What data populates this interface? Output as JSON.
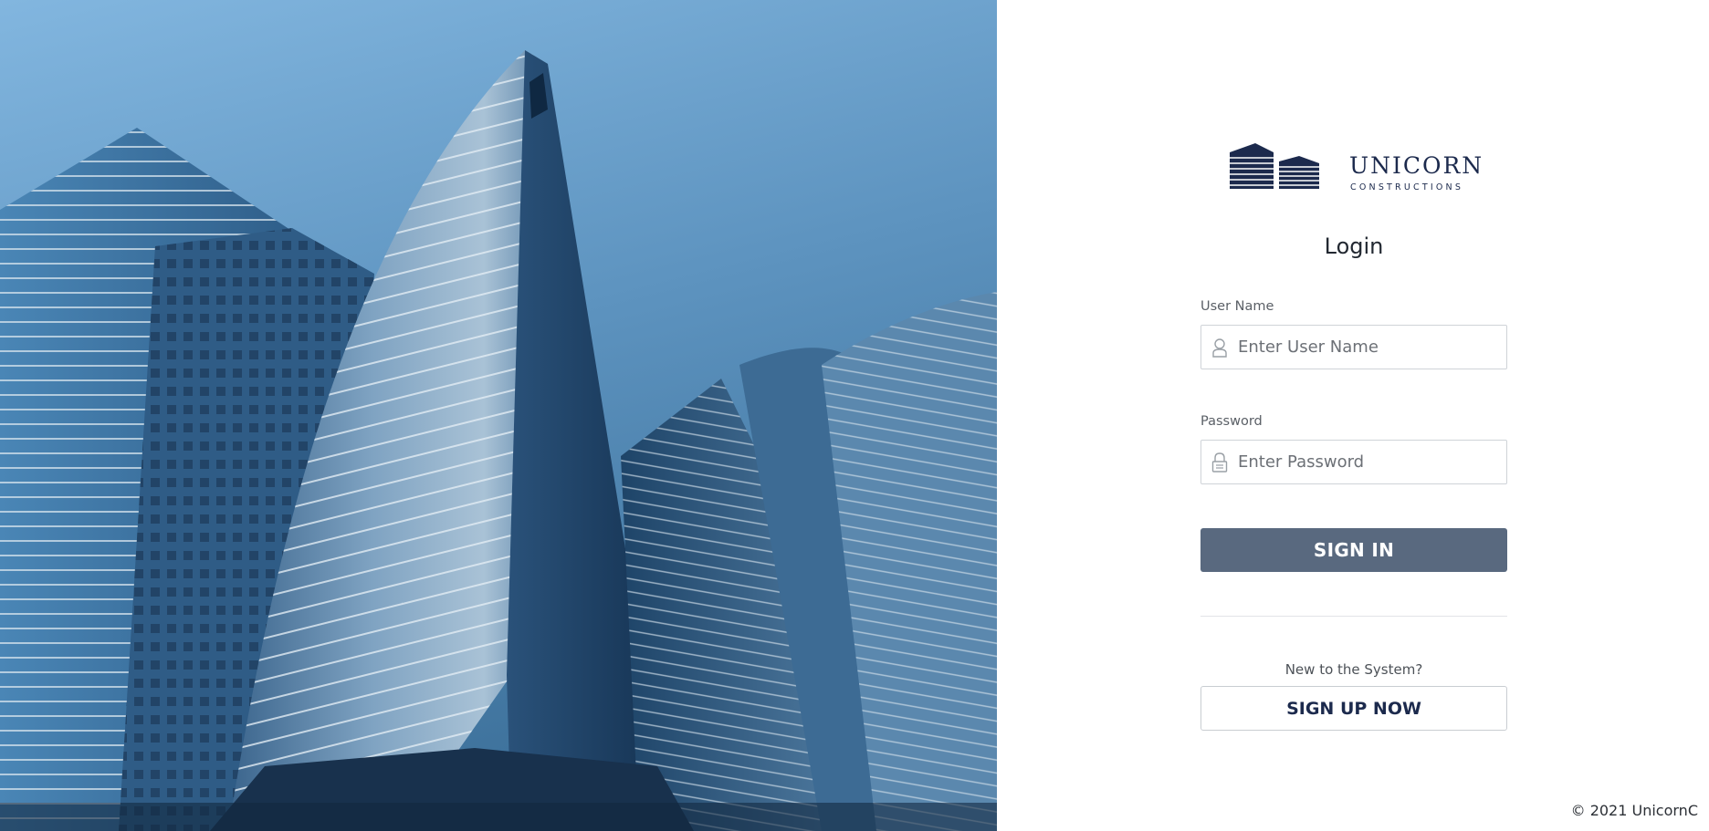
{
  "hero": {
    "image_description_icon": "office-towers-photo"
  },
  "brand": {
    "name": "UNICORN",
    "tagline": "CONSTRUCTIONS",
    "logo_icon": "buildings-logo-icon",
    "color": "#1c2a4d"
  },
  "login": {
    "title": "Login",
    "username": {
      "label": "User Name",
      "placeholder": "Enter User Name",
      "value": "",
      "icon": "user-icon"
    },
    "password": {
      "label": "Password",
      "placeholder": "Enter Password",
      "value": "",
      "icon": "lock-icon"
    },
    "signin_label": "SIGN IN",
    "signin_color": "#59697f",
    "new_prompt": "New to the System?",
    "signup_label": "SIGN UP NOW"
  },
  "footer": {
    "copyright": "© 2021 UnicornC"
  }
}
